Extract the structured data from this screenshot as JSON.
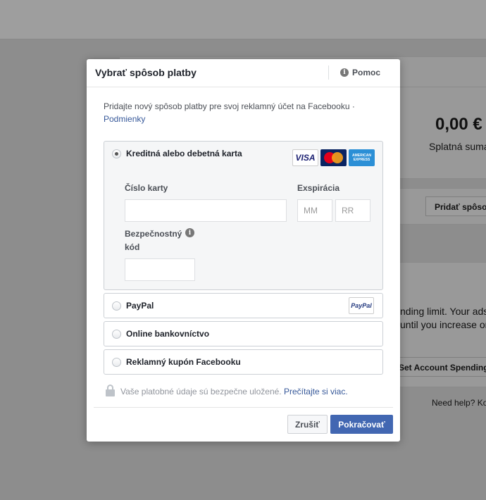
{
  "background": {
    "amount": "0,00 €",
    "amount_label": "Splatná suma",
    "add_button": "Pridať spôso",
    "limit_line1": "nding limit. Your ads",
    "limit_line2": "until you increase or",
    "spending_button": "Set Account Spending",
    "need_help": "Need help? Ko"
  },
  "dialog": {
    "title": "Vybrať spôsob platby",
    "help": "Pomoc",
    "intro": "Pridajte nový spôsob platby pre svoj reklamný účet na Facebooku ·",
    "terms_link": "Podmienky",
    "card_option": {
      "label": "Kreditná alebo debetná karta",
      "selected": true,
      "logos": [
        "VISA",
        "MasterCard",
        "AMERICAN EXPRESS"
      ],
      "card_number_label": "Číslo karty",
      "card_number_value": "",
      "expiry_label": "Exspirácia",
      "month_placeholder": "MM",
      "year_placeholder": "RR",
      "security_label_1": "Bezpečnostný",
      "security_label_2": "kód",
      "security_value": ""
    },
    "options": [
      {
        "label": "PayPal",
        "logo": "PayPal",
        "selected": false
      },
      {
        "label": "Online bankovníctvo",
        "selected": false
      },
      {
        "label": "Reklamný kupón Facebooku",
        "selected": false
      }
    ],
    "secure_note": "Vaše platobné údaje sú bezpečne uložené.",
    "learn_more": "Prečítajte si viac.",
    "cancel": "Zrušiť",
    "continue": "Pokračovať"
  },
  "colors": {
    "primary": "#4267b2",
    "link": "#365899",
    "overlay": "#8d8d8d"
  }
}
